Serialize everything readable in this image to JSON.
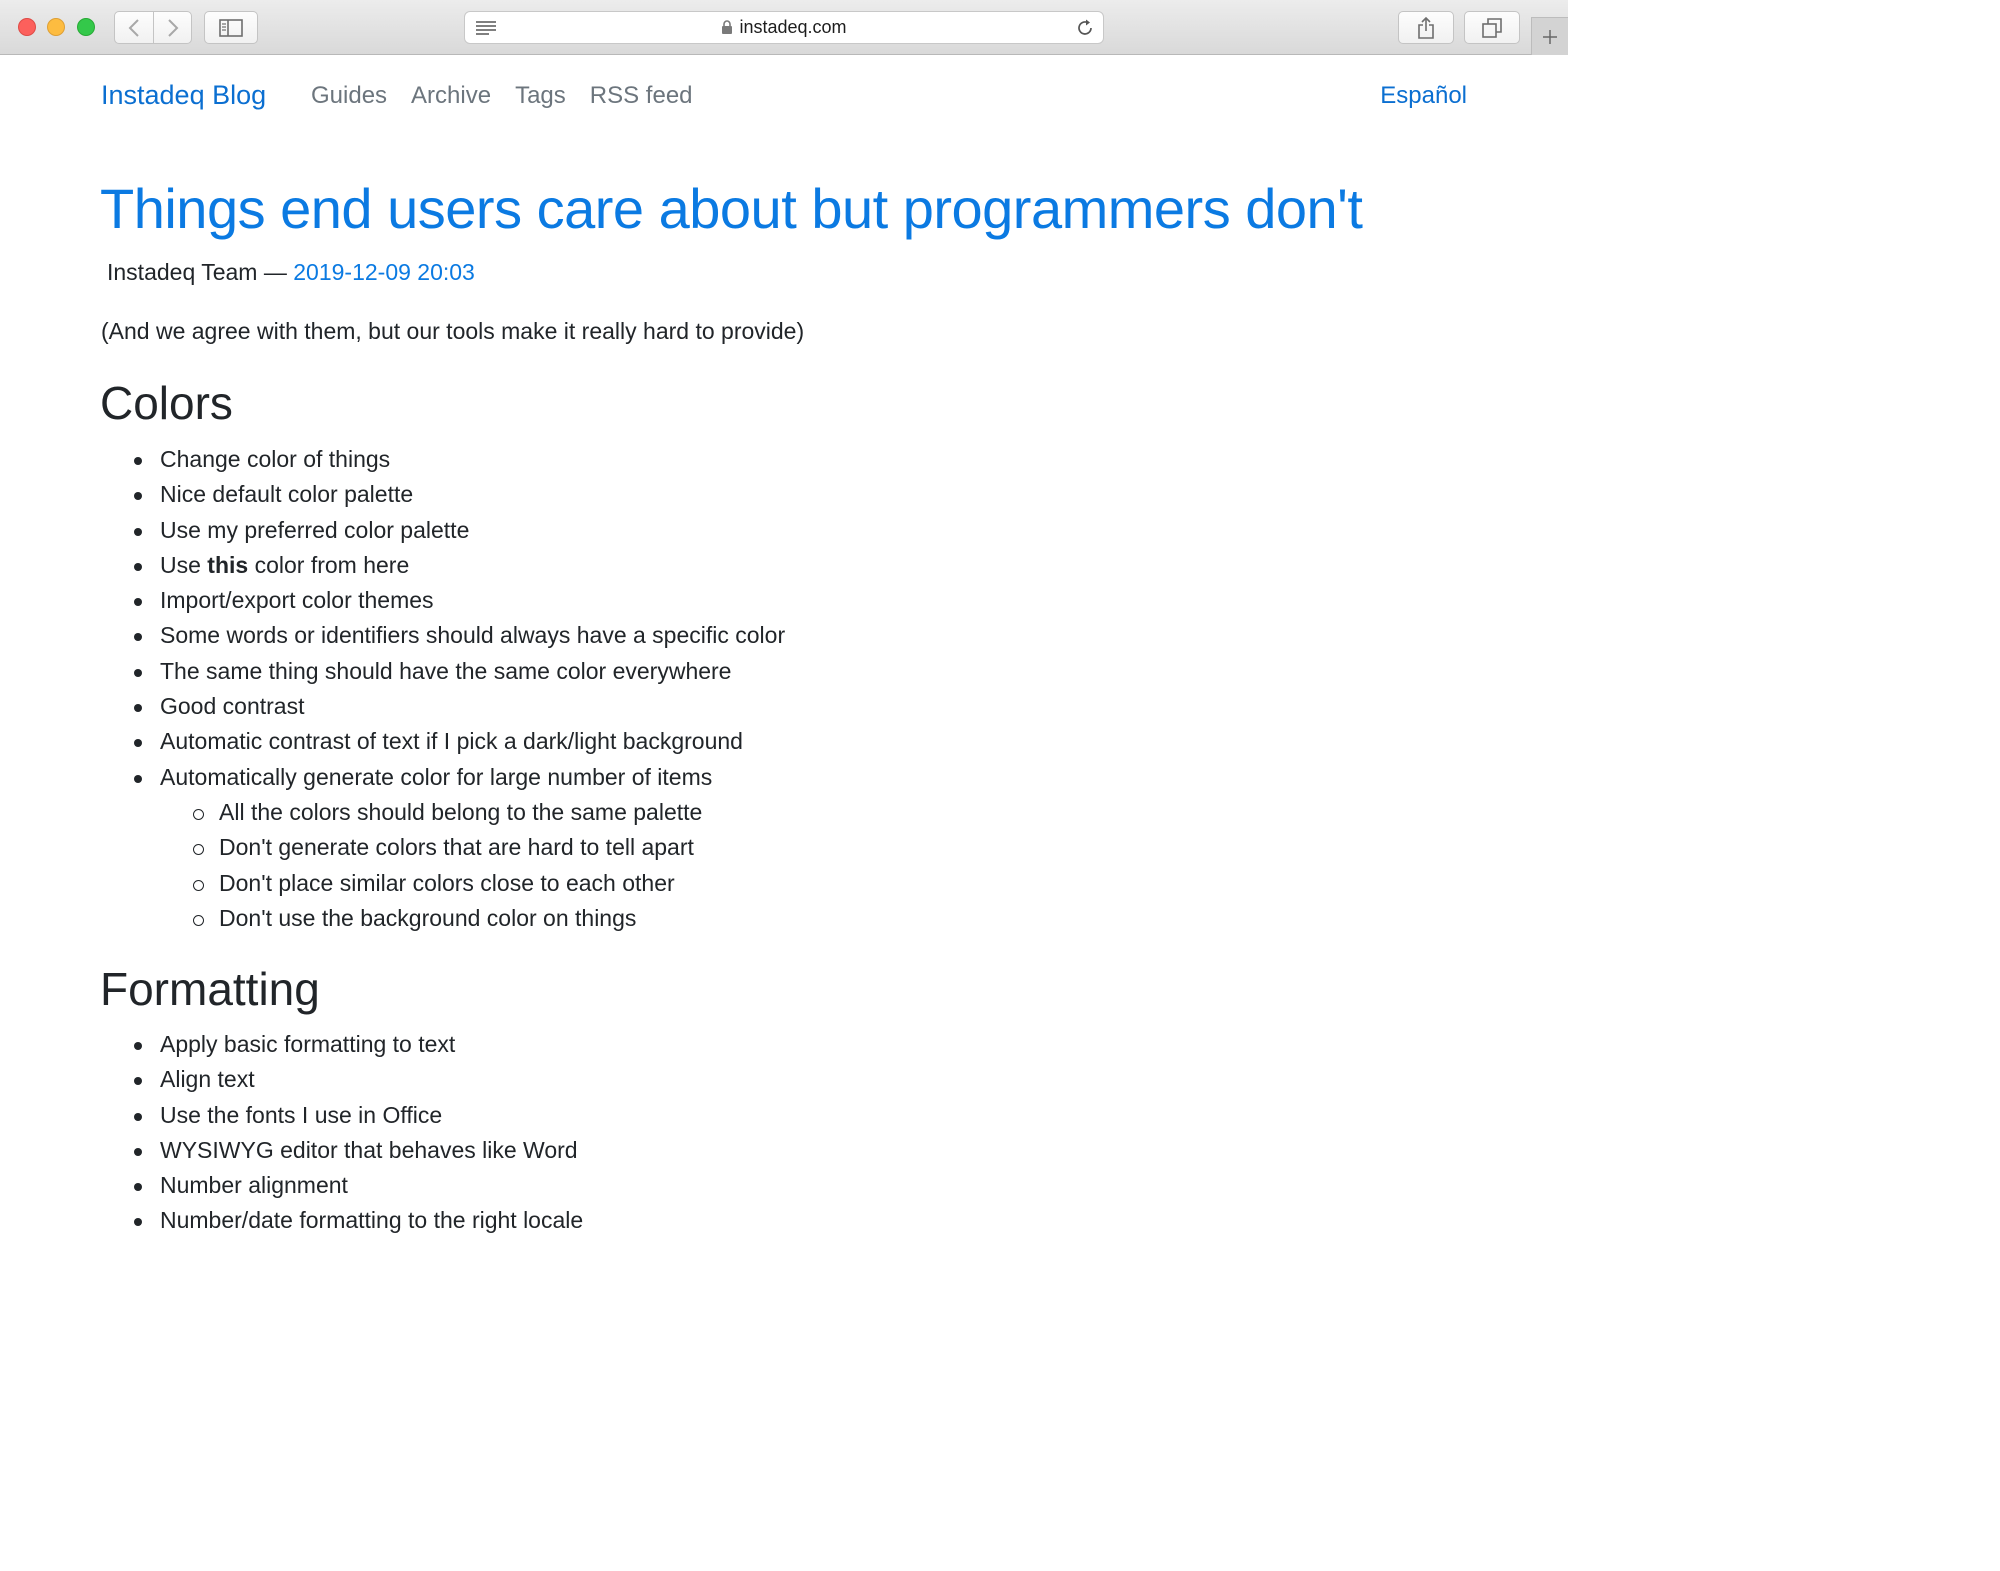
{
  "browser": {
    "url": "instadeq.com",
    "icons": [
      "back-icon",
      "forward-icon",
      "sidebar-icon",
      "reader-icon",
      "lock-icon",
      "reload-icon",
      "share-icon",
      "tabs-icon",
      "plus-icon"
    ]
  },
  "nav": {
    "brand": "Instadeq Blog",
    "links": [
      "Guides",
      "Archive",
      "Tags",
      "RSS feed"
    ],
    "language": "Español"
  },
  "post": {
    "title": "Things end users care about but programmers don't",
    "author": "Instadeq Team —",
    "date": "2019-12-09 20:03",
    "intro": "(And we agree with them, but our tools make it really hard to provide)"
  },
  "sections": {
    "colors": {
      "heading": "Colors",
      "items": [
        "Change color of things",
        "Nice default color palette",
        "Use my preferred color palette",
        {
          "before": "Use ",
          "bold": "this",
          "after": " color from here"
        },
        "Import/export color themes",
        "Some words or identifiers should always have a specific color",
        "The same thing should have the same color everywhere",
        "Good contrast",
        "Automatic contrast of text if I pick a dark/light background",
        "Automatically generate color for large number of items",
        "All the colors should belong to the same palette",
        "Don't generate colors that are hard to tell apart",
        "Don't place similar colors close to each other",
        "Don't use the background color on things"
      ]
    },
    "formatting": {
      "heading": "Formatting",
      "items": [
        "Apply basic formatting to text",
        "Align text",
        "Use the fonts I use in Office",
        "WYSIWYG editor that behaves like Word",
        "Number alignment",
        "Number/date formatting to the right locale"
      ]
    }
  }
}
